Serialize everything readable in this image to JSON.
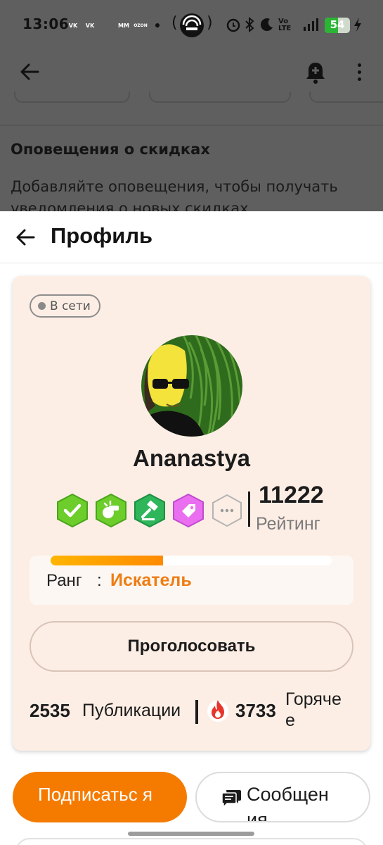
{
  "status_bar": {
    "time": "13:06",
    "apps": [
      {
        "icon": "vk-icon",
        "text": "VK",
        "color": "#2787f5"
      },
      {
        "icon": "vk-icon",
        "text": "VK",
        "color": "#2787f5"
      },
      {
        "icon": "cloud-icon",
        "text": "",
        "color": "#2a6ce6"
      },
      {
        "icon": "megamarket-icon",
        "text": "MM",
        "color": "#e6342c"
      },
      {
        "icon": "ozon-icon",
        "text": "OZON",
        "color": "#b233d6"
      }
    ],
    "battery_level": 54,
    "battery_text": "54",
    "network": "Vo LTE"
  },
  "background_page": {
    "section_title": "Оповещения о скидках",
    "section_description": "Добавляйте оповещения, чтобы получать уведомления о новых скидках"
  },
  "sheet": {
    "title": "Профиль"
  },
  "profile": {
    "online_status": "В сети",
    "username": "Ananastya",
    "badges": [
      {
        "name": "verified-badge",
        "color": "#6ccd2b",
        "dark": "#4aa51a",
        "glyph": "check"
      },
      {
        "name": "whistle-badge",
        "color": "#6ccd2b",
        "dark": "#4aa51a",
        "glyph": "whistle"
      },
      {
        "name": "gavel-badge",
        "color": "#2fb55a",
        "dark": "#1e8f43",
        "glyph": "gavel"
      },
      {
        "name": "tag-badge",
        "color": "#ea6ef0",
        "dark": "#c24ad0",
        "glyph": "tag"
      },
      {
        "name": "more-badges",
        "color": "#fdeee5",
        "dark": "#b4b4b4",
        "glyph": "more"
      }
    ],
    "rating_value": "11222",
    "rating_label": "Рейтинг",
    "rank_label": "Ранг",
    "rank_separator": ":",
    "rank_value": "Искатель",
    "rank_progress": 0.4,
    "vote_button": "Проголосовать",
    "publications_count": "2535",
    "publications_label": "Публикации",
    "hot_count": "3733",
    "hot_label": "Горяче е"
  },
  "actions": {
    "subscribe_label": "Подписатьс я",
    "message_label": "Сообщен ия"
  },
  "colors": {
    "accent": "#f57b00",
    "rank": "#ee7d13",
    "card_bg": "#fdeee5"
  }
}
